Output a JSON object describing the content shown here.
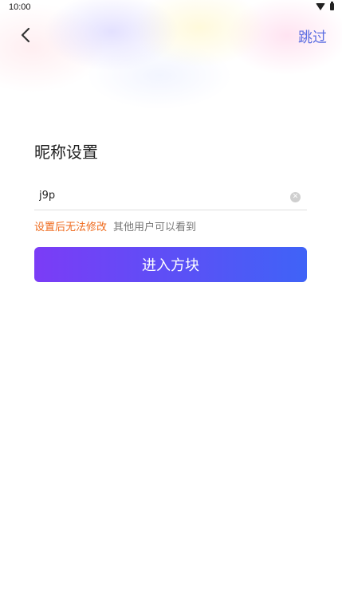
{
  "status_bar": {
    "time": "10:00",
    "icons": [
      "wifi-icon",
      "battery-icon"
    ]
  },
  "header": {
    "back_icon": "chevron-left-icon",
    "skip_label": "跳过",
    "skip_color": "#5b6ee1"
  },
  "main": {
    "title": "昵称设置",
    "nickname_input": {
      "value": "j9p",
      "placeholder": ""
    },
    "clear_icon": "clear-circle-icon",
    "hint_warning": "设置后无法修改",
    "hint_info": "其他用户可以看到",
    "hint_warning_color": "#ef6a1c",
    "enter_button_label": "进入方块",
    "enter_button_colors": [
      "#7b3cf6",
      "#3f63f7"
    ]
  }
}
